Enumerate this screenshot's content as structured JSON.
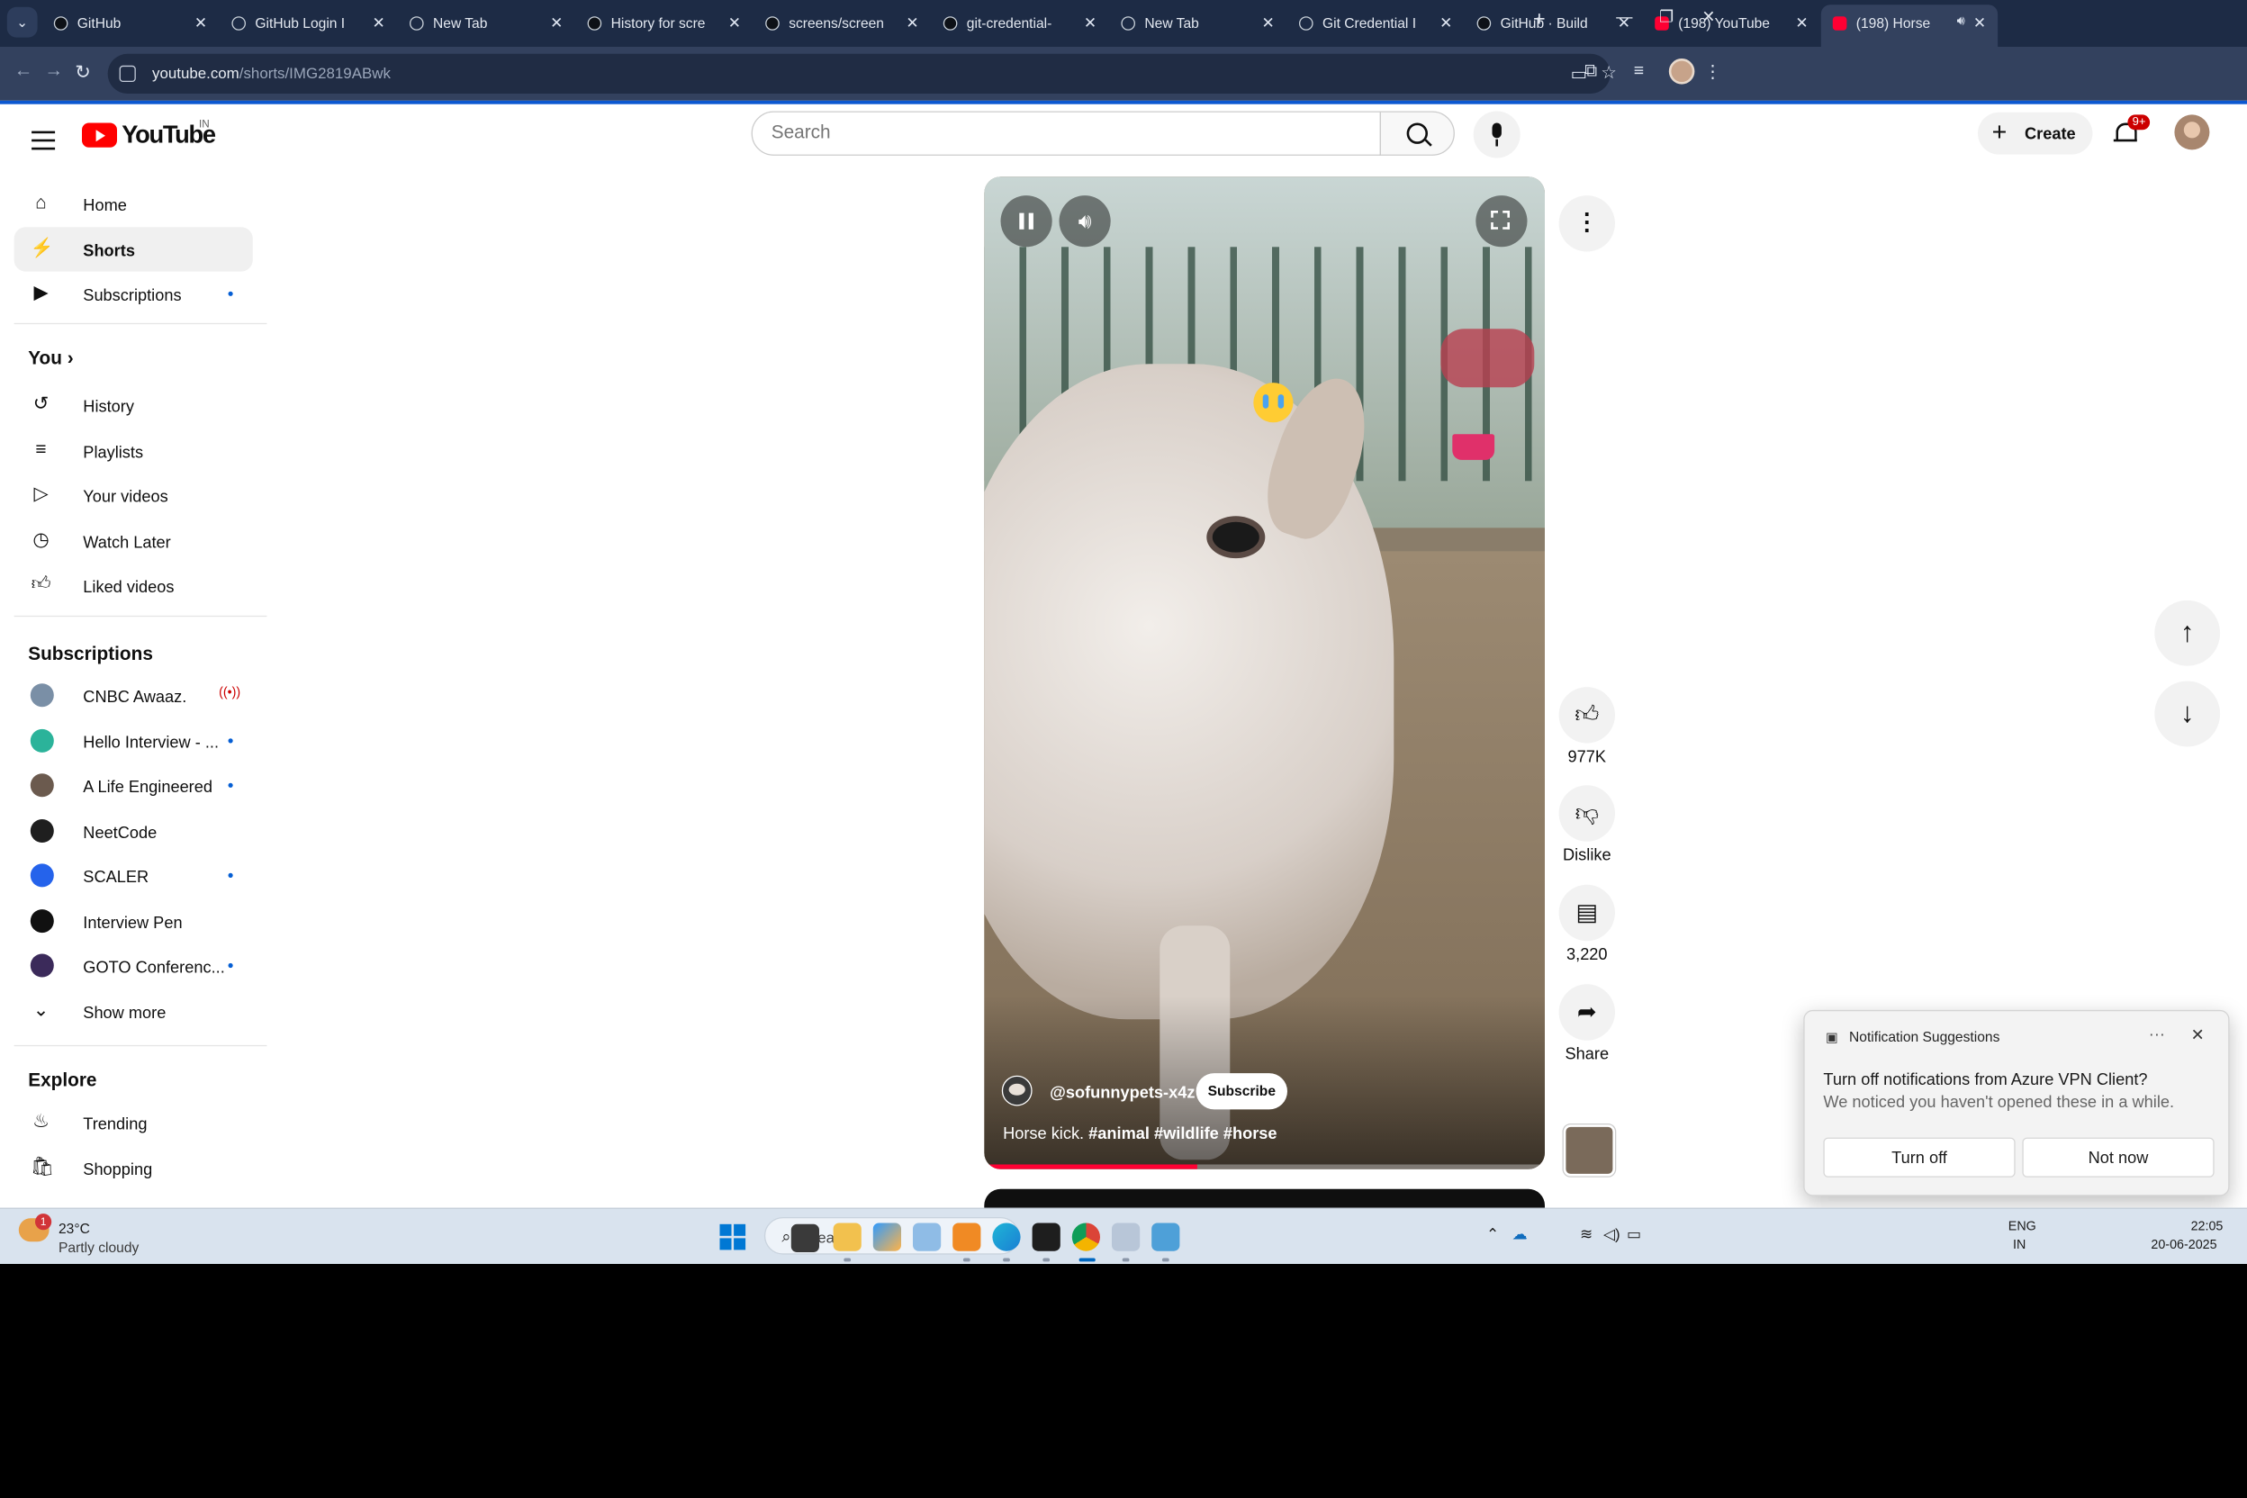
{
  "browser": {
    "tabs": [
      {
        "label": "GitHub",
        "favicon": "github-icon"
      },
      {
        "label": "GitHub Login I",
        "favicon": "globe-icon"
      },
      {
        "label": "New Tab",
        "favicon": "globe-icon"
      },
      {
        "label": "History for scre",
        "favicon": "github-icon"
      },
      {
        "label": "screens/screen",
        "favicon": "github-icon"
      },
      {
        "label": "git-credential-",
        "favicon": "github-icon"
      },
      {
        "label": "New Tab",
        "favicon": "globe-icon"
      },
      {
        "label": "Git Credential I",
        "favicon": "globe-icon"
      },
      {
        "label": "GitHub · Build",
        "favicon": "github-icon"
      },
      {
        "label": "(198) YouTube",
        "favicon": "youtube-icon"
      },
      {
        "label": "(198) Horse",
        "favicon": "youtube-icon",
        "active": true
      }
    ],
    "url_host": "youtube.com",
    "url_path": "/shorts/IMG2819ABwk"
  },
  "youtube": {
    "logo_text": "YouTube",
    "country_code": "IN",
    "search_placeholder": "Search",
    "create_label": "Create",
    "notification_count": "9+"
  },
  "sidebar": {
    "main": [
      {
        "label": "Home",
        "icon": "home-icon"
      },
      {
        "label": "Shorts",
        "icon": "shorts-icon",
        "active": true
      },
      {
        "label": "Subscriptions",
        "icon": "subscriptions-icon",
        "new": true
      }
    ],
    "you_heading": "You",
    "you_items": [
      {
        "label": "History",
        "icon": "history-icon"
      },
      {
        "label": "Playlists",
        "icon": "playlists-icon"
      },
      {
        "label": "Your videos",
        "icon": "your-videos-icon"
      },
      {
        "label": "Watch Later",
        "icon": "clock-icon"
      },
      {
        "label": "Liked videos",
        "icon": "thumbs-up-icon"
      }
    ],
    "subscriptions_heading": "Subscriptions",
    "subscriptions": [
      {
        "label": "CNBC Awaaz.",
        "live": true,
        "color": "#7a8fa6"
      },
      {
        "label": "Hello Interview - ...",
        "new": true,
        "color": "#2bb39a"
      },
      {
        "label": "A Life Engineered",
        "new": true,
        "color": "#6b5a4e"
      },
      {
        "label": "NeetCode",
        "new": false,
        "color": "#1f1f1f"
      },
      {
        "label": "SCALER",
        "new": true,
        "color": "#2563eb"
      },
      {
        "label": "Interview Pen",
        "new": false,
        "color": "#111111"
      },
      {
        "label": "GOTO Conferenc...",
        "new": true,
        "color": "#3b2a5a"
      }
    ],
    "show_more": "Show more",
    "explore_heading": "Explore",
    "explore": [
      {
        "label": "Trending",
        "icon": "trending-icon"
      },
      {
        "label": "Shopping",
        "icon": "shopping-icon"
      }
    ]
  },
  "short": {
    "channel_handle": "@sofunnypets-x4z",
    "subscribe_label": "Subscribe",
    "caption_text": "Horse kick. ",
    "hashtags": [
      "#animal",
      "#wildlife",
      "#horse"
    ],
    "progress_fraction": 0.38
  },
  "actions": {
    "like_count": "977K",
    "dislike_label": "Dislike",
    "comment_count": "3,220",
    "share_label": "Share"
  },
  "notification": {
    "title": "Notification Suggestions",
    "heading": "Turn off notifications from Azure VPN Client?",
    "body": "We noticed you haven't opened these in a while.",
    "turn_off_label": "Turn off",
    "not_now_label": "Not now"
  },
  "taskbar": {
    "weather_temp": "23°C",
    "weather_condition": "Partly cloudy",
    "weather_badge": "1",
    "search_label": "Search",
    "lang_top": "ENG",
    "lang_bottom": "IN",
    "time": "22:05",
    "date": "20-06-2025"
  }
}
